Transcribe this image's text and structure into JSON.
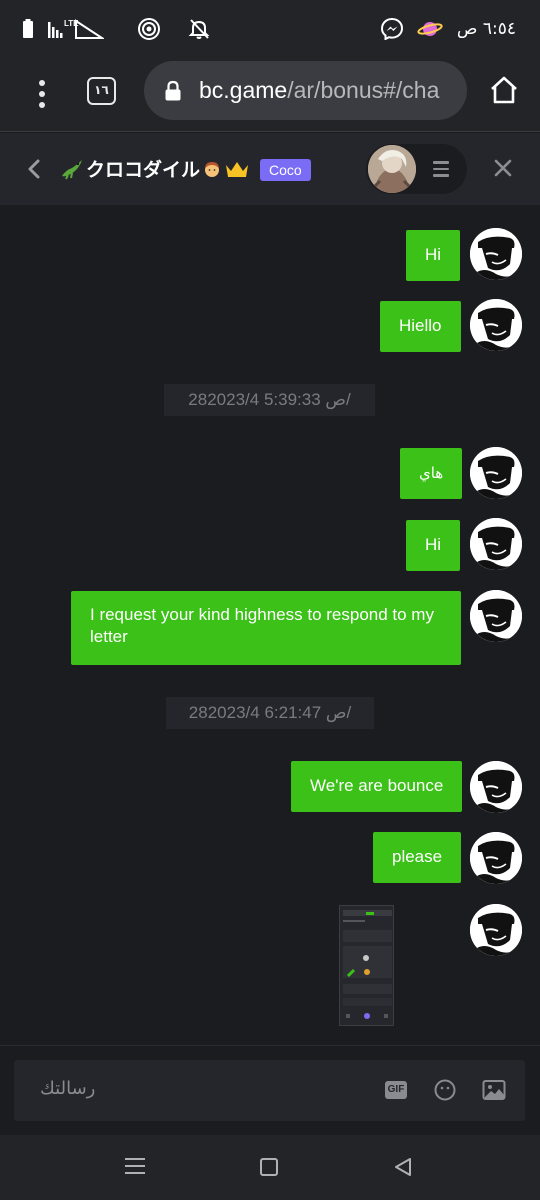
{
  "status_bar": {
    "time": "٦:٥٤ ص",
    "network_label": "LTE",
    "icons": [
      "battery-icon",
      "signal-icon",
      "hotspot-icon",
      "mute-icon",
      "messenger-icon",
      "saturn-app-icon"
    ]
  },
  "browser": {
    "tab_count": "١٦",
    "url_host": "bc.game",
    "url_path": "/ar/bonus#/cha"
  },
  "chat": {
    "title": "クロコダイル",
    "badge": "Coco"
  },
  "messages": [
    {
      "type": "text",
      "text": "Hi"
    },
    {
      "type": "text",
      "text": "Hiello"
    },
    {
      "type": "timestamp",
      "text": "28ص 5:39:33 2023/4/"
    },
    {
      "type": "text",
      "text": "هاي"
    },
    {
      "type": "text",
      "text": "Hi"
    },
    {
      "type": "text",
      "text": "I request your kind highness to respond to my letter"
    },
    {
      "type": "timestamp",
      "text": "28ص 6:21:47 2023/4/"
    },
    {
      "type": "text",
      "text": "We're are bounce"
    },
    {
      "type": "text",
      "text": "please"
    },
    {
      "type": "image",
      "text": ""
    }
  ],
  "composer": {
    "placeholder": "رسالتك",
    "gif_label": "GIF"
  },
  "colors": {
    "bubble": "#3bc117",
    "badge": "#7b6cf6",
    "background": "#1b1c20"
  }
}
